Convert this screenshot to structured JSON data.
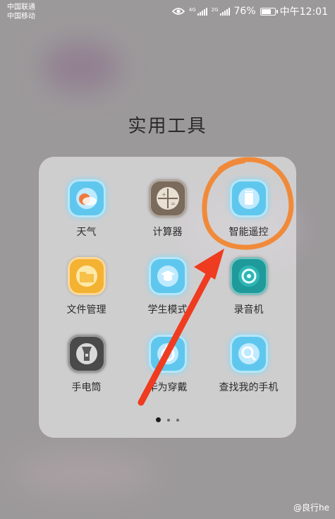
{
  "status": {
    "carrier1": "中国联通",
    "carrier2": "中国移动",
    "sig1_tag": "4G",
    "sig2_tag": "2G",
    "battery": "76%",
    "battery_level": 0.76,
    "time": "中午12:01"
  },
  "folder": {
    "title": "实用工具",
    "apps": [
      {
        "label": "天气",
        "icon": "weather-icon"
      },
      {
        "label": "计算器",
        "icon": "calculator-icon"
      },
      {
        "label": "智能遥控",
        "icon": "remote-control-icon"
      },
      {
        "label": "文件管理",
        "icon": "folder-icon"
      },
      {
        "label": "学生模式",
        "icon": "student-mode-icon"
      },
      {
        "label": "录音机",
        "icon": "recorder-icon"
      },
      {
        "label": "手电筒",
        "icon": "flashlight-icon"
      },
      {
        "label": "华为穿戴",
        "icon": "wearable-icon"
      },
      {
        "label": "查找我的手机",
        "icon": "find-phone-icon"
      }
    ],
    "page_count": 3,
    "active_page": 1
  },
  "annotation": {
    "circle_color": "#f08a3a",
    "arrow_color": "#ef3b1f"
  },
  "watermark": "@良行he"
}
